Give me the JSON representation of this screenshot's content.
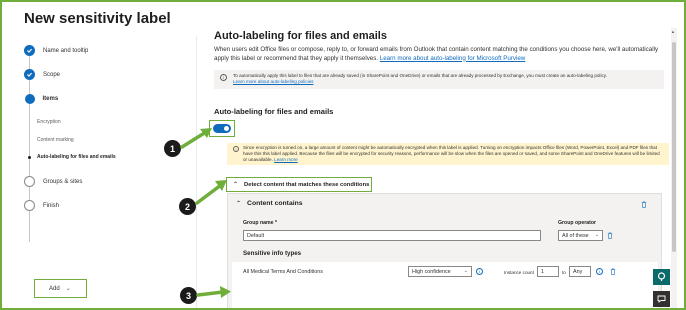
{
  "page_title": "New sensitivity label",
  "wizard": {
    "steps": [
      {
        "label": "Name and tooltip",
        "state": "done"
      },
      {
        "label": "Scope",
        "state": "done"
      },
      {
        "label": "Items",
        "state": "current"
      },
      {
        "label": "Groups & sites",
        "state": "open"
      },
      {
        "label": "Finish",
        "state": "open"
      }
    ],
    "substeps": [
      "Encryption",
      "Content marking",
      "Auto-labeling for files and emails"
    ]
  },
  "main": {
    "heading": "Auto-labeling for files and emails",
    "description": "When users edit Office files or compose, reply to, or forward emails from Outlook that contain content matching the conditions you choose here, we'll automatically apply this label or recommend that they apply it themselves.",
    "description_link": "Learn more about auto-labeling for Microsoft Purview",
    "info_text": "To automatically apply this label to files that are already saved (in SharePoint and OneDrive) or emails that are already processed by Exchange, you must create an auto-labeling policy.",
    "info_link": "Learn more about auto-labeling policies",
    "section_heading": "Auto-labeling for files and emails",
    "toggle_on": true,
    "warning_text": "Since encryption is turned on, a large amount of content might be automatically encrypted when this label is applied. Turning on encryption impacts Office files (Word, PowerPoint, Excel) and PDF files that have this this label applied. Because the files will be encrypted for security reasons, performance will be slow when the files are opened or saved, and some SharePoint and OneDrive features will be limited or unavailable.",
    "warning_link": "Learn more",
    "detect_label": "Detect content that matches these conditions",
    "panel": {
      "title": "Content contains",
      "group_name_label": "Group name *",
      "group_name_value": "Default",
      "group_operator_label": "Group operator",
      "group_operator_value": "All of these",
      "sit_heading": "Sensitive info types",
      "sit_name": "All Medical Terms And Conditions",
      "confidence_value": "High confidence",
      "instance_label": "Instance count",
      "instance_min": "1",
      "instance_to": "to",
      "instance_max": "Any"
    },
    "add_label": "Add"
  },
  "callouts": [
    "1",
    "2",
    "3"
  ],
  "colors": {
    "accent": "#0f6cbd",
    "highlight": "#6fae3a",
    "warning_bg": "#fff4ce",
    "side_button": "#0b6a6a"
  }
}
